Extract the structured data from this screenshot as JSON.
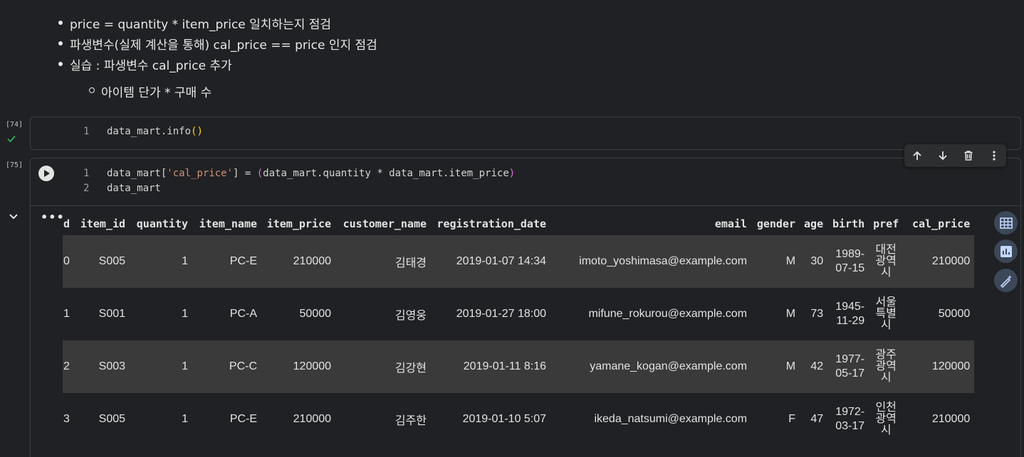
{
  "markdown": {
    "bullets": [
      "price = quantity * item_price 일치하는지 점검",
      "파생변수(실제 계산을 통해) cal_price == price 인지 점검",
      "실습 : 파생변수 cal_price 추가"
    ],
    "subbullet": "아이템 단가 * 구매 수"
  },
  "cell74": {
    "exec_count": "[74]",
    "line_no": "1",
    "code": "data_mart.info()",
    "status_icon": "check-icon"
  },
  "cell75": {
    "exec_count": "[75]",
    "line1_no": "1",
    "line2_no": "2",
    "line1_a": "data_mart[",
    "line1_str": "'cal_price'",
    "line1_b": "] = ",
    "line1_c": "(data_mart.quantity * data_mart.item_price",
    "line1_d": ")",
    "line2": "data_mart"
  },
  "toolbar": {
    "icons": [
      "arrow-up-icon",
      "arrow-down-icon",
      "trash-icon",
      "more-vert-icon"
    ]
  },
  "output": {
    "menu_label": "•••",
    "columns": [
      "d",
      "item_id",
      "quantity",
      "item_name",
      "item_price",
      "customer_name",
      "registration_date",
      "email",
      "gender",
      "age",
      "birth",
      "pref",
      "cal_price"
    ],
    "rows": [
      {
        "idx": "0",
        "item_id": "S005",
        "quantity": "1",
        "item_name": "PC-E",
        "item_price": "210000",
        "customer_name": "김태경",
        "registration_date": "2019-01-07 14:34",
        "email": "imoto_yoshimasa@example.com",
        "gender": "M",
        "age": "30",
        "birth1": "1989-",
        "birth2": "07-15",
        "pref1": "대전",
        "pref2": "광역",
        "pref3": "시",
        "cal_price": "210000"
      },
      {
        "idx": "1",
        "item_id": "S001",
        "quantity": "1",
        "item_name": "PC-A",
        "item_price": "50000",
        "customer_name": "김영웅",
        "registration_date": "2019-01-27 18:00",
        "email": "mifune_rokurou@example.com",
        "gender": "M",
        "age": "73",
        "birth1": "1945-",
        "birth2": "11-29",
        "pref1": "서울",
        "pref2": "특별",
        "pref3": "시",
        "cal_price": "50000"
      },
      {
        "idx": "2",
        "item_id": "S003",
        "quantity": "1",
        "item_name": "PC-C",
        "item_price": "120000",
        "customer_name": "김강현",
        "registration_date": "2019-01-11 8:16",
        "email": "yamane_kogan@example.com",
        "gender": "M",
        "age": "42",
        "birth1": "1977-",
        "birth2": "05-17",
        "pref1": "광주",
        "pref2": "광역",
        "pref3": "시",
        "cal_price": "120000"
      },
      {
        "idx": "3",
        "item_id": "S005",
        "quantity": "1",
        "item_name": "PC-E",
        "item_price": "210000",
        "customer_name": "김주한",
        "registration_date": "2019-01-10 5:07",
        "email": "ikeda_natsumi@example.com",
        "gender": "F",
        "age": "47",
        "birth1": "1972-",
        "birth2": "03-17",
        "pref1": "인천",
        "pref2": "광역",
        "pref3": "시",
        "cal_price": "210000"
      }
    ]
  },
  "side_buttons": [
    "table-icon",
    "chart-icon",
    "magic-wand-icon"
  ]
}
